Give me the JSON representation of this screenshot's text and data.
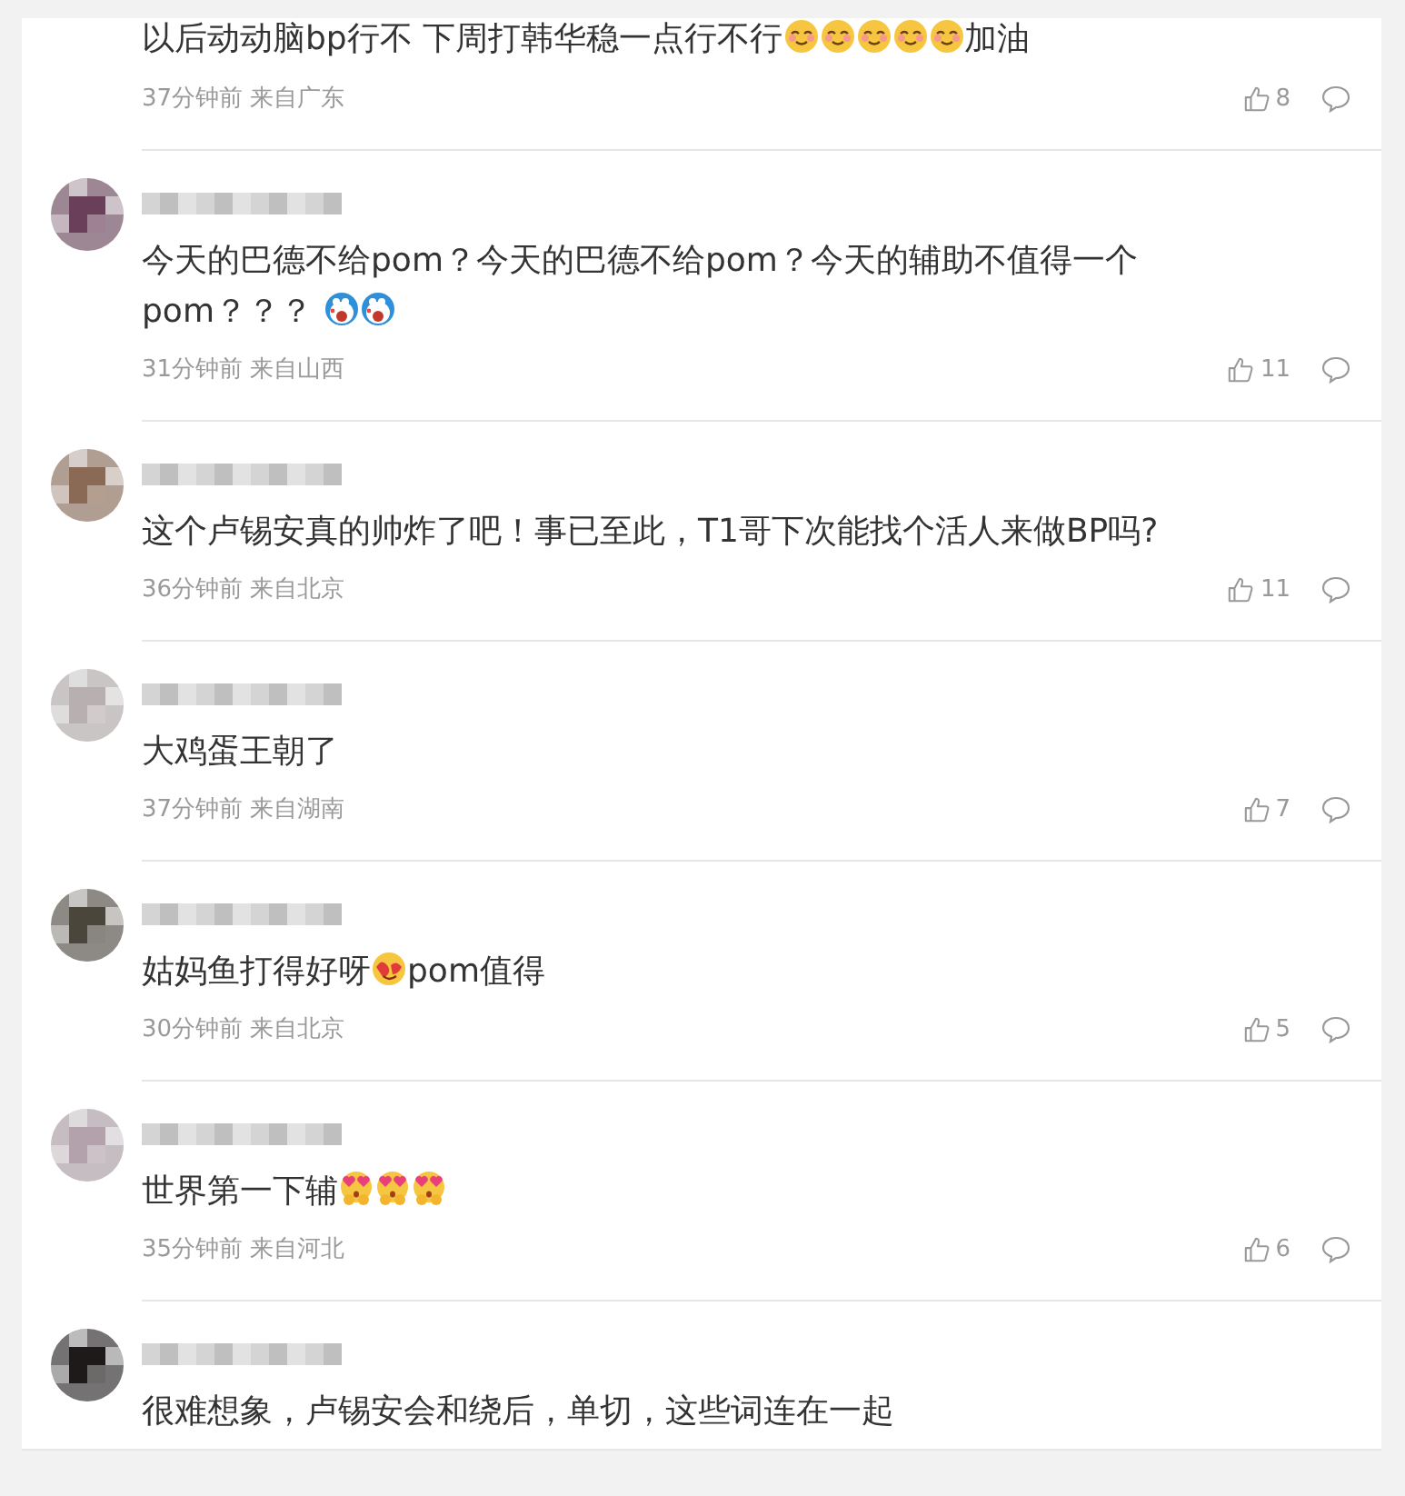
{
  "comments": [
    {
      "segments": [
        {
          "kind": "text",
          "text": "以后动动脑bp行不 下周打韩华稳一点行不行"
        },
        {
          "kind": "smile"
        },
        {
          "kind": "smile"
        },
        {
          "kind": "smile"
        },
        {
          "kind": "smile"
        },
        {
          "kind": "smile"
        },
        {
          "kind": "text",
          "text": "加油"
        }
      ],
      "meta": "37分钟前 来自广东",
      "likes": "8"
    },
    {
      "avatar": {
        "color": "#6a3f5a"
      },
      "segments": [
        {
          "kind": "text",
          "text": "今天的巴德不给pom？今天的巴德不给pom？今天的辅助不值得一个"
        },
        {
          "kind": "break"
        },
        {
          "kind": "text",
          "text": "pom？？？ "
        },
        {
          "kind": "blue-face"
        },
        {
          "kind": "blue-face"
        }
      ],
      "meta": "31分钟前 来自山西",
      "likes": "11"
    },
    {
      "avatar": {
        "color": "#8a6a55"
      },
      "segments": [
        {
          "kind": "text",
          "text": "这个卢锡安真的帅炸了吧！事已至此，T1哥下次能找个活人来做BP吗?"
        }
      ],
      "meta": "36分钟前 来自北京",
      "likes": "11"
    },
    {
      "avatar": {
        "color": "#b8b0b0"
      },
      "segments": [
        {
          "kind": "text",
          "text": "大鸡蛋王朝了"
        }
      ],
      "meta": "37分钟前 来自湖南",
      "likes": "7"
    },
    {
      "avatar": {
        "color": "#4a463c"
      },
      "segments": [
        {
          "kind": "text",
          "text": "姑妈鱼打得好呀"
        },
        {
          "kind": "love"
        },
        {
          "kind": "text",
          "text": "pom值得"
        }
      ],
      "meta": "30分钟前 来自北京",
      "likes": "5"
    },
    {
      "avatar": {
        "color": "#b3a2ab"
      },
      "segments": [
        {
          "kind": "text",
          "text": "世界第一下辅"
        },
        {
          "kind": "heart-eyes"
        },
        {
          "kind": "heart-eyes"
        },
        {
          "kind": "heart-eyes"
        }
      ],
      "meta": "35分钟前 来自河北",
      "likes": "6"
    },
    {
      "avatar": {
        "color": "#1e1a1a"
      },
      "segments": [
        {
          "kind": "text",
          "text": "很难想象，卢锡安会和绕后，单切，这些词连在一起"
        }
      ]
    }
  ]
}
